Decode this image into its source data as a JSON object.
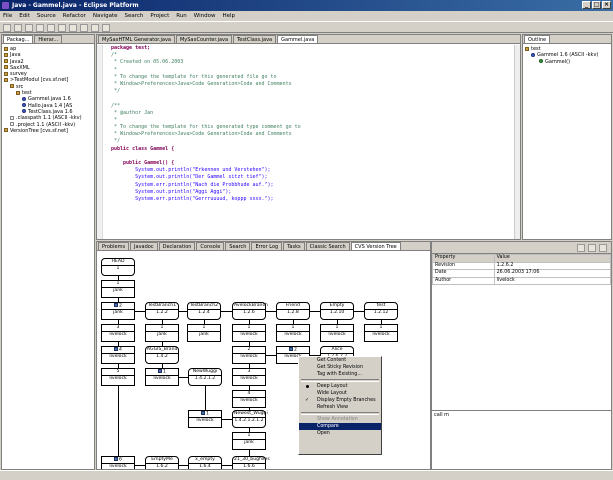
{
  "window": {
    "title": "Java - Gammel.java - Eclipse Platform",
    "controls": [
      "_",
      "□",
      "×"
    ]
  },
  "menu": [
    "File",
    "Edit",
    "Source",
    "Refactor",
    "Navigate",
    "Search",
    "Project",
    "Run",
    "Window",
    "Help"
  ],
  "left_tabs": [
    "Packag...",
    "Hierar..."
  ],
  "tree": [
    {
      "indent": 0,
      "icon": "folder",
      "label": "ap"
    },
    {
      "indent": 0,
      "icon": "folder",
      "label": "Java"
    },
    {
      "indent": 0,
      "icon": "folder",
      "label": "Java2"
    },
    {
      "indent": 0,
      "icon": "folder",
      "label": "SaxXML"
    },
    {
      "indent": 0,
      "icon": "folder",
      "label": "survey"
    },
    {
      "indent": 0,
      "icon": "folder",
      "label": ">TestModul [cvs.sf.net]"
    },
    {
      "indent": 1,
      "icon": "folder",
      "label": "src"
    },
    {
      "indent": 2,
      "icon": "folder",
      "label": "test"
    },
    {
      "indent": 3,
      "icon": "java",
      "label": "Gammel.java 1.6"
    },
    {
      "indent": 3,
      "icon": "java",
      "label": "Hallo.java 1.4 [AS"
    },
    {
      "indent": 3,
      "icon": "java",
      "label": "TestClass.java 1.6"
    },
    {
      "indent": 1,
      "icon": "file",
      "label": ".classpath 1.1 (ASCII -kkv)"
    },
    {
      "indent": 1,
      "icon": "file",
      "label": ".project 1.1 (ASCII -kkv)"
    },
    {
      "indent": 0,
      "icon": "folder",
      "label": "VersionTree [cvs.sf.net]"
    }
  ],
  "editor_tabs": [
    "MySaxHTML Generator.java",
    "MySaxCounter.java",
    "TestClass.java",
    "Gammel.java"
  ],
  "code": [
    {
      "t": "kw",
      "s": "package test;"
    },
    {
      "t": "cm",
      "s": "/*"
    },
    {
      "t": "cm",
      "s": " * Created on 05.06.2003"
    },
    {
      "t": "cm",
      "s": " *"
    },
    {
      "t": "cm",
      "s": " * To change the template for this generated file go to"
    },
    {
      "t": "cm",
      "s": " * Window>Preferences>Java>Code Generation>Code and Comments"
    },
    {
      "t": "cm",
      "s": " */"
    },
    {
      "t": "",
      "s": ""
    },
    {
      "t": "cm",
      "s": "/**"
    },
    {
      "t": "cm",
      "s": " * @author Jan"
    },
    {
      "t": "cm",
      "s": " *"
    },
    {
      "t": "cm",
      "s": " * To change the template for this generated type comment go to"
    },
    {
      "t": "cm",
      "s": " * Window>Preferences>Java>Code Generation>Code and Comments"
    },
    {
      "t": "cm",
      "s": " */"
    },
    {
      "t": "kw",
      "s": "public class Gammel {"
    },
    {
      "t": "",
      "s": ""
    },
    {
      "t": "kw",
      "s": "    public Gammel() {"
    },
    {
      "t": "st",
      "s": "        System.out.println(\"Erkennen und Verstehen\");"
    },
    {
      "t": "st",
      "s": "        System.out.println(\"Der Gammel sitzt tief\");"
    },
    {
      "t": "st",
      "s": "        System.err.println(\"Nach die Probbhude auf.\");"
    },
    {
      "t": "st",
      "s": "        System.out.println(\"Aggi Aggi\");"
    },
    {
      "t": "st",
      "s": "        System.err.println(\"Gerrruuuud, koppp xxxx.\");"
    }
  ],
  "outline": {
    "tab": "Outline",
    "items": [
      "test",
      "Gammel 1.6 (ASCII -kkv)",
      "Gammel()"
    ]
  },
  "bottom_tabs": [
    "Problems",
    "Javadoc",
    "Declaration",
    "Console",
    "Search",
    "Error Log",
    "Tasks",
    "Classic Search",
    "CVS Version Tree"
  ],
  "graph": {
    "nodes": [
      {
        "id": "head",
        "label": "HEAD",
        "value": "1",
        "round": true
      },
      {
        "id": "n1",
        "label": "1",
        "value": "jank",
        "round": false
      },
      {
        "id": "n2",
        "label": "2",
        "value": "jank",
        "round": false,
        "icon": true
      },
      {
        "id": "tb1",
        "label": "TestBranch1",
        "value": "1.2.2",
        "round": true
      },
      {
        "id": "tb2",
        "label": "TestBranch2",
        "value": "1.2.4",
        "round": true
      },
      {
        "id": "jb",
        "label": "AvelockBranch",
        "value": "1.2.6",
        "round": true
      },
      {
        "id": "fr",
        "label": "Friend",
        "value": "1.2.8",
        "round": true
      },
      {
        "id": "em",
        "label": "Empty",
        "value": "1.2.10",
        "round": true
      },
      {
        "id": "te",
        "label": "test",
        "value": "1.2.12",
        "round": true
      },
      {
        "id": "n3",
        "label": "3",
        "value": "livelock",
        "round": false
      },
      {
        "id": "b1",
        "label": "1",
        "value": "jank",
        "round": false
      },
      {
        "id": "b2",
        "label": "1",
        "value": "jank",
        "round": false
      },
      {
        "id": "j1",
        "label": "1",
        "value": "livelock",
        "round": false
      },
      {
        "id": "f1",
        "label": "1",
        "value": "livelock",
        "round": false
      },
      {
        "id": "e1",
        "label": "1",
        "value": "livelock",
        "round": false
      },
      {
        "id": "t1",
        "label": "1",
        "value": "livelock",
        "round": false
      },
      {
        "id": "n4",
        "label": "4",
        "value": "livelock",
        "round": false,
        "icon": true
      },
      {
        "id": "ag",
        "label": "AGGIS_Brand",
        "value": "1.4.2",
        "round": true
      },
      {
        "id": "j2",
        "label": "2",
        "value": "livelock",
        "round": false
      },
      {
        "id": "j2b",
        "label": "2",
        "value": "livelock",
        "round": false,
        "icon": true
      },
      {
        "id": "al",
        "label": "Alice",
        "value": "1.2.6.2.2",
        "round": true
      },
      {
        "id": "n5",
        "label": "5",
        "value": "livelock",
        "round": false
      },
      {
        "id": "ag1",
        "label": "1",
        "value": "livelock",
        "round": false,
        "icon": true
      },
      {
        "id": "nw",
        "label": "NewWuggi",
        "value": "1.4.2.1.2",
        "round": true
      },
      {
        "id": "j3",
        "label": "3",
        "value": "livelock",
        "round": false
      },
      {
        "id": "j4",
        "label": "4",
        "value": "livelock",
        "round": false
      },
      {
        "id": "nw1",
        "label": "1",
        "value": "livelock",
        "round": false,
        "icon": true
      },
      {
        "id": "nnw",
        "label": "Newest_Wuggi",
        "value": "1.4.2.1.2.1.2",
        "round": true
      },
      {
        "id": "jk",
        "label": "1",
        "value": "jank",
        "round": false
      },
      {
        "id": "n6",
        "label": "6",
        "value": "livelock",
        "round": false,
        "icon": true
      },
      {
        "id": "emm",
        "label": "EmptyMe",
        "value": "1.6.2",
        "round": true
      },
      {
        "id": "xe",
        "label": "x_empty",
        "value": "1.6.4",
        "round": true
      },
      {
        "id": "bug",
        "label": "21_30_bugfixes",
        "value": "1.6.6",
        "round": true
      }
    ]
  },
  "context_menu": {
    "items": [
      {
        "label": "Get Content",
        "state": ""
      },
      {
        "label": "Get Sticky Revision",
        "state": ""
      },
      {
        "label": "Tag with Existing...",
        "state": ""
      },
      {
        "sep": true
      },
      {
        "label": "Deep Layout",
        "state": "dot"
      },
      {
        "label": "Wide Layout",
        "state": ""
      },
      {
        "label": "Display Empty Branches",
        "state": "chk"
      },
      {
        "label": "Refresh View",
        "state": ""
      },
      {
        "sep": true
      },
      {
        "label": "Show Annotation",
        "state": "dis"
      },
      {
        "label": "Compare",
        "state": "hi"
      },
      {
        "label": "Open",
        "state": ""
      }
    ]
  },
  "properties": {
    "headers": [
      "Property",
      "Value"
    ],
    "rows": [
      [
        "Revision",
        "1.2.6.2"
      ],
      [
        "Date",
        "26.06.2003 17:06"
      ],
      [
        "Author",
        "livelock"
      ]
    ],
    "comment": "call m"
  },
  "colors": {
    "title_start": "#0a246a",
    "title_end": "#3a6ea5",
    "selection": "#0a246a",
    "keyword": "#7f0055",
    "comment": "#3f7f5f",
    "string": "#2a00ff"
  }
}
